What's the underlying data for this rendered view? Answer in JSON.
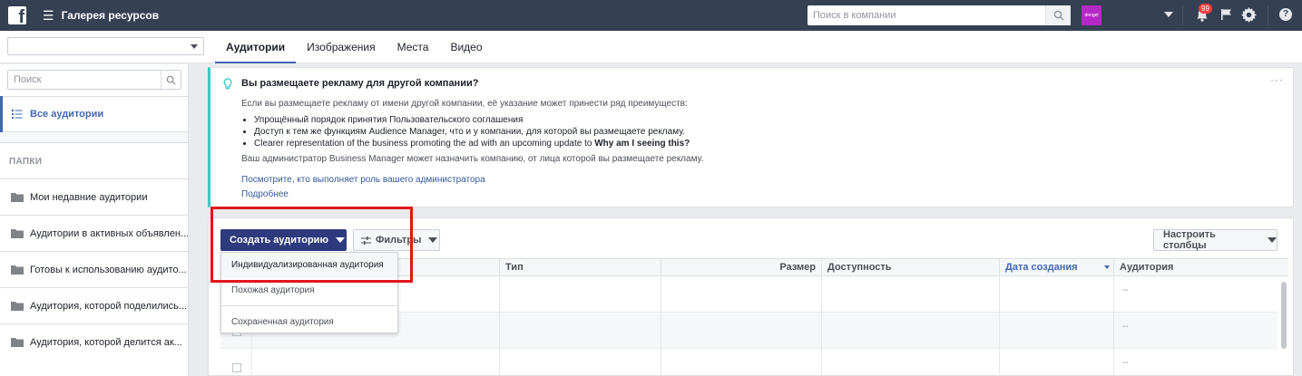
{
  "header": {
    "logo": "f",
    "title": "Галерея ресурсов",
    "search_placeholder": "Поиск в компании",
    "avatar_text": "dengel",
    "notifications": "99"
  },
  "tabs": [
    "Аудитории",
    "Изображения",
    "Места",
    "Видео"
  ],
  "sidebar": {
    "search_placeholder": "Поиск",
    "all_audiences": "Все аудитории",
    "folders_header": "ПАПКИ",
    "folders": [
      "Мои недавние аудитории",
      "Аудитории в активных объявлен...",
      "Готовы к использованию аудито...",
      "Аудитория, которой поделились...",
      "Аудитория, которой делится ак..."
    ]
  },
  "info": {
    "title": "Вы размещаете рекламу для другой компании?",
    "intro": "Если вы размещаете рекламу от имени другой компании, её указание может принести ряд преимуществ:",
    "bullets": [
      "Упрощённый порядок принятия Пользовательского соглашения",
      "Доступ к тем же функциям Audience Manager, что и у компании, для которой вы размещаете рекламу.",
      "Clearer representation of the business promoting the ad with an upcoming update to "
    ],
    "bullet3_bold": "Why am I seeing this?",
    "note": "Ваш администратор Business Manager может назначить компанию, от лица которой вы размещаете рекламу.",
    "link_admin": "Посмотрите, кто выполняет роль вашего администратора",
    "link_more": "Подробнее"
  },
  "toolbar": {
    "create": "Создать аудиторию",
    "filters": "Фильтры",
    "columns": "Настроить столбцы"
  },
  "table": {
    "headers": [
      "Тип",
      "Размер",
      "Доступность",
      "Дата создания",
      "Аудитория"
    ],
    "audience_values": [
      "--",
      "--",
      "--"
    ]
  },
  "dropdown": {
    "items": [
      "Индивидуализированная аудитория",
      "Похожая аудитория",
      "Сохраненная аудитория"
    ]
  },
  "colors": {
    "topbar": "#354052",
    "primary_button": "#2d3a7d",
    "highlight_box": "#e0161b",
    "info_accent": "#3bc9c3"
  }
}
